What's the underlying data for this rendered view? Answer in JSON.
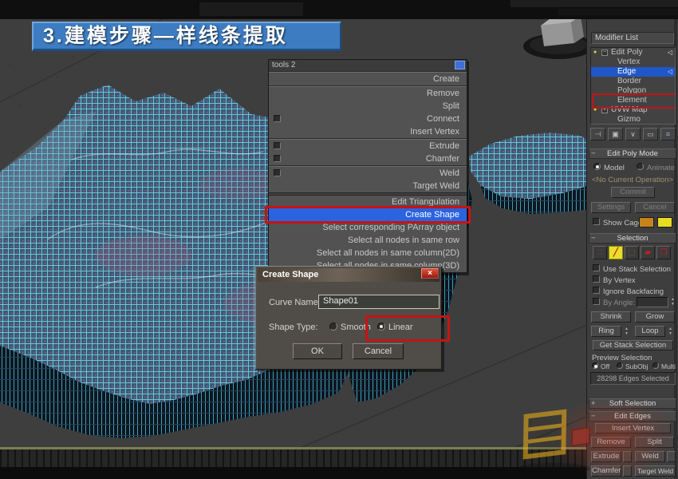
{
  "colors": {
    "banner_blue": "#3d7cc1",
    "highlight_blue": "#2a63e0",
    "annotation_red": "#c51414",
    "cage_orange": "#c8821a",
    "cage_yellow": "#e8dc20"
  },
  "icons": {
    "close": "×",
    "collapse": "−",
    "expand": "+",
    "bulb": "●",
    "stack_arrow": "◁",
    "spin_up": "▲",
    "spin_down": "▼",
    "pin_stack": "⊣",
    "show_end_result": "▣",
    "make_unique": "∨",
    "remove_modifier": "▭",
    "configure_sets": "≡",
    "edge_glyph": "╱",
    "vertex_glyph": "∷",
    "border_glyph": "▢",
    "polygon_glyph": "▰",
    "element_glyph": "❒"
  },
  "title_banner": {
    "text": "3.建模步骤—样线条提取"
  },
  "context_menu": {
    "title": "tools 2",
    "items": [
      {
        "label": "Create"
      },
      {
        "label": "Remove"
      },
      {
        "label": "Split"
      },
      {
        "label": "Connect"
      },
      {
        "label": "Insert Vertex"
      },
      {
        "label": "Extrude"
      },
      {
        "label": "Chamfer"
      },
      {
        "label": "Weld"
      },
      {
        "label": "Target Weld"
      },
      {
        "label": "Edit Triangulation"
      },
      {
        "label": "Create Shape"
      },
      {
        "label": "Select corresponding PArray object"
      },
      {
        "label": "Select all nodes in same row"
      },
      {
        "label": "Select all nodes in same column(2D)"
      },
      {
        "label": "Select all nodes in same column(3D)"
      }
    ]
  },
  "dialog": {
    "title": "Create Shape",
    "curve_name_label": "Curve Name:",
    "curve_name_value": "Shape01",
    "shape_type_label": "Shape Type:",
    "smooth_label": "Smooth",
    "linear_label": "Linear",
    "ok_label": "OK",
    "cancel_label": "Cancel"
  },
  "panel": {
    "modifier_list": "Modifier List",
    "stack": {
      "items": [
        "Edit Poly",
        "Vertex",
        "Edge",
        "Border",
        "Polygon",
        "Element",
        "UVW Map",
        "Gizmo"
      ]
    },
    "edit_poly_mode": {
      "header": "Edit Poly Mode",
      "model": "Model",
      "animate": "Animate",
      "no_op": "<No Current Operation>",
      "commit": "Commit",
      "settings": "Settings",
      "cancel": "Cancel",
      "show_cage": "Show Cage"
    },
    "selection": {
      "header": "Selection",
      "use_stack": "Use Stack Selection",
      "by_vertex": "By Vertex",
      "ignore_backfacing": "Ignore Backfacing",
      "by_angle": "By Angle:",
      "shrink": "Shrink",
      "grow": "Grow",
      "ring": "Ring",
      "loop": "Loop",
      "get_stack": "Get Stack Selection",
      "preview": "Preview Selection",
      "off": "Off",
      "subobj": "SubObj",
      "multi": "Multi",
      "status": "28298 Edges Selected"
    },
    "soft_selection": {
      "header": "Soft Selection"
    },
    "edit_edges": {
      "header": "Edit Edges",
      "insert_vertex": "Insert Vertex",
      "remove": "Remove",
      "split": "Split",
      "extrude": "Extrude",
      "weld": "Weld",
      "chamfer": "Chamfer",
      "target_weld": "Target Weld"
    }
  }
}
